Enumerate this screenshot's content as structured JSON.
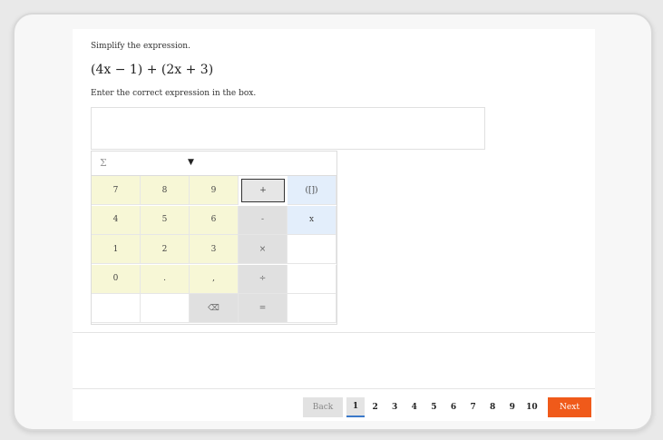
{
  "question": {
    "prompt": "Simplify the expression.",
    "expression": "(4x − 1) + (2x + 3)",
    "instruction": "Enter the correct expression in the box."
  },
  "answer_box": {
    "value": ""
  },
  "keypad": {
    "symbol_menu": "Σ",
    "keys": [
      {
        "label": "7",
        "style": "y"
      },
      {
        "label": "8",
        "style": "y"
      },
      {
        "label": "9",
        "style": "y"
      },
      {
        "label": "+",
        "style": "active"
      },
      {
        "label": "([])",
        "style": "b"
      },
      {
        "label": "4",
        "style": "y"
      },
      {
        "label": "5",
        "style": "y"
      },
      {
        "label": "6",
        "style": "y"
      },
      {
        "label": "-",
        "style": "g"
      },
      {
        "label": "x",
        "style": "b"
      },
      {
        "label": "1",
        "style": "y"
      },
      {
        "label": "2",
        "style": "y"
      },
      {
        "label": "3",
        "style": "y"
      },
      {
        "label": "×",
        "style": "g"
      },
      {
        "label": "",
        "style": "w"
      },
      {
        "label": "0",
        "style": "y"
      },
      {
        "label": ".",
        "style": "y"
      },
      {
        "label": ",",
        "style": "y"
      },
      {
        "label": "÷",
        "style": "g"
      },
      {
        "label": "",
        "style": "w"
      },
      {
        "label": "",
        "style": "w"
      },
      {
        "label": "",
        "style": "w"
      },
      {
        "label": "⌫",
        "style": "g"
      },
      {
        "label": "=",
        "style": "g"
      },
      {
        "label": "",
        "style": "w"
      }
    ]
  },
  "navigation": {
    "back_label": "Back",
    "pages": [
      "1",
      "2",
      "3",
      "4",
      "5",
      "6",
      "7",
      "8",
      "9",
      "10"
    ],
    "current_page": "1",
    "next_label": "Next"
  },
  "colors": {
    "next": "#f05a1a",
    "keypad_digit": "#f7f7d6",
    "keypad_op": "#e0e0e0",
    "keypad_func": "#e3eefb"
  }
}
